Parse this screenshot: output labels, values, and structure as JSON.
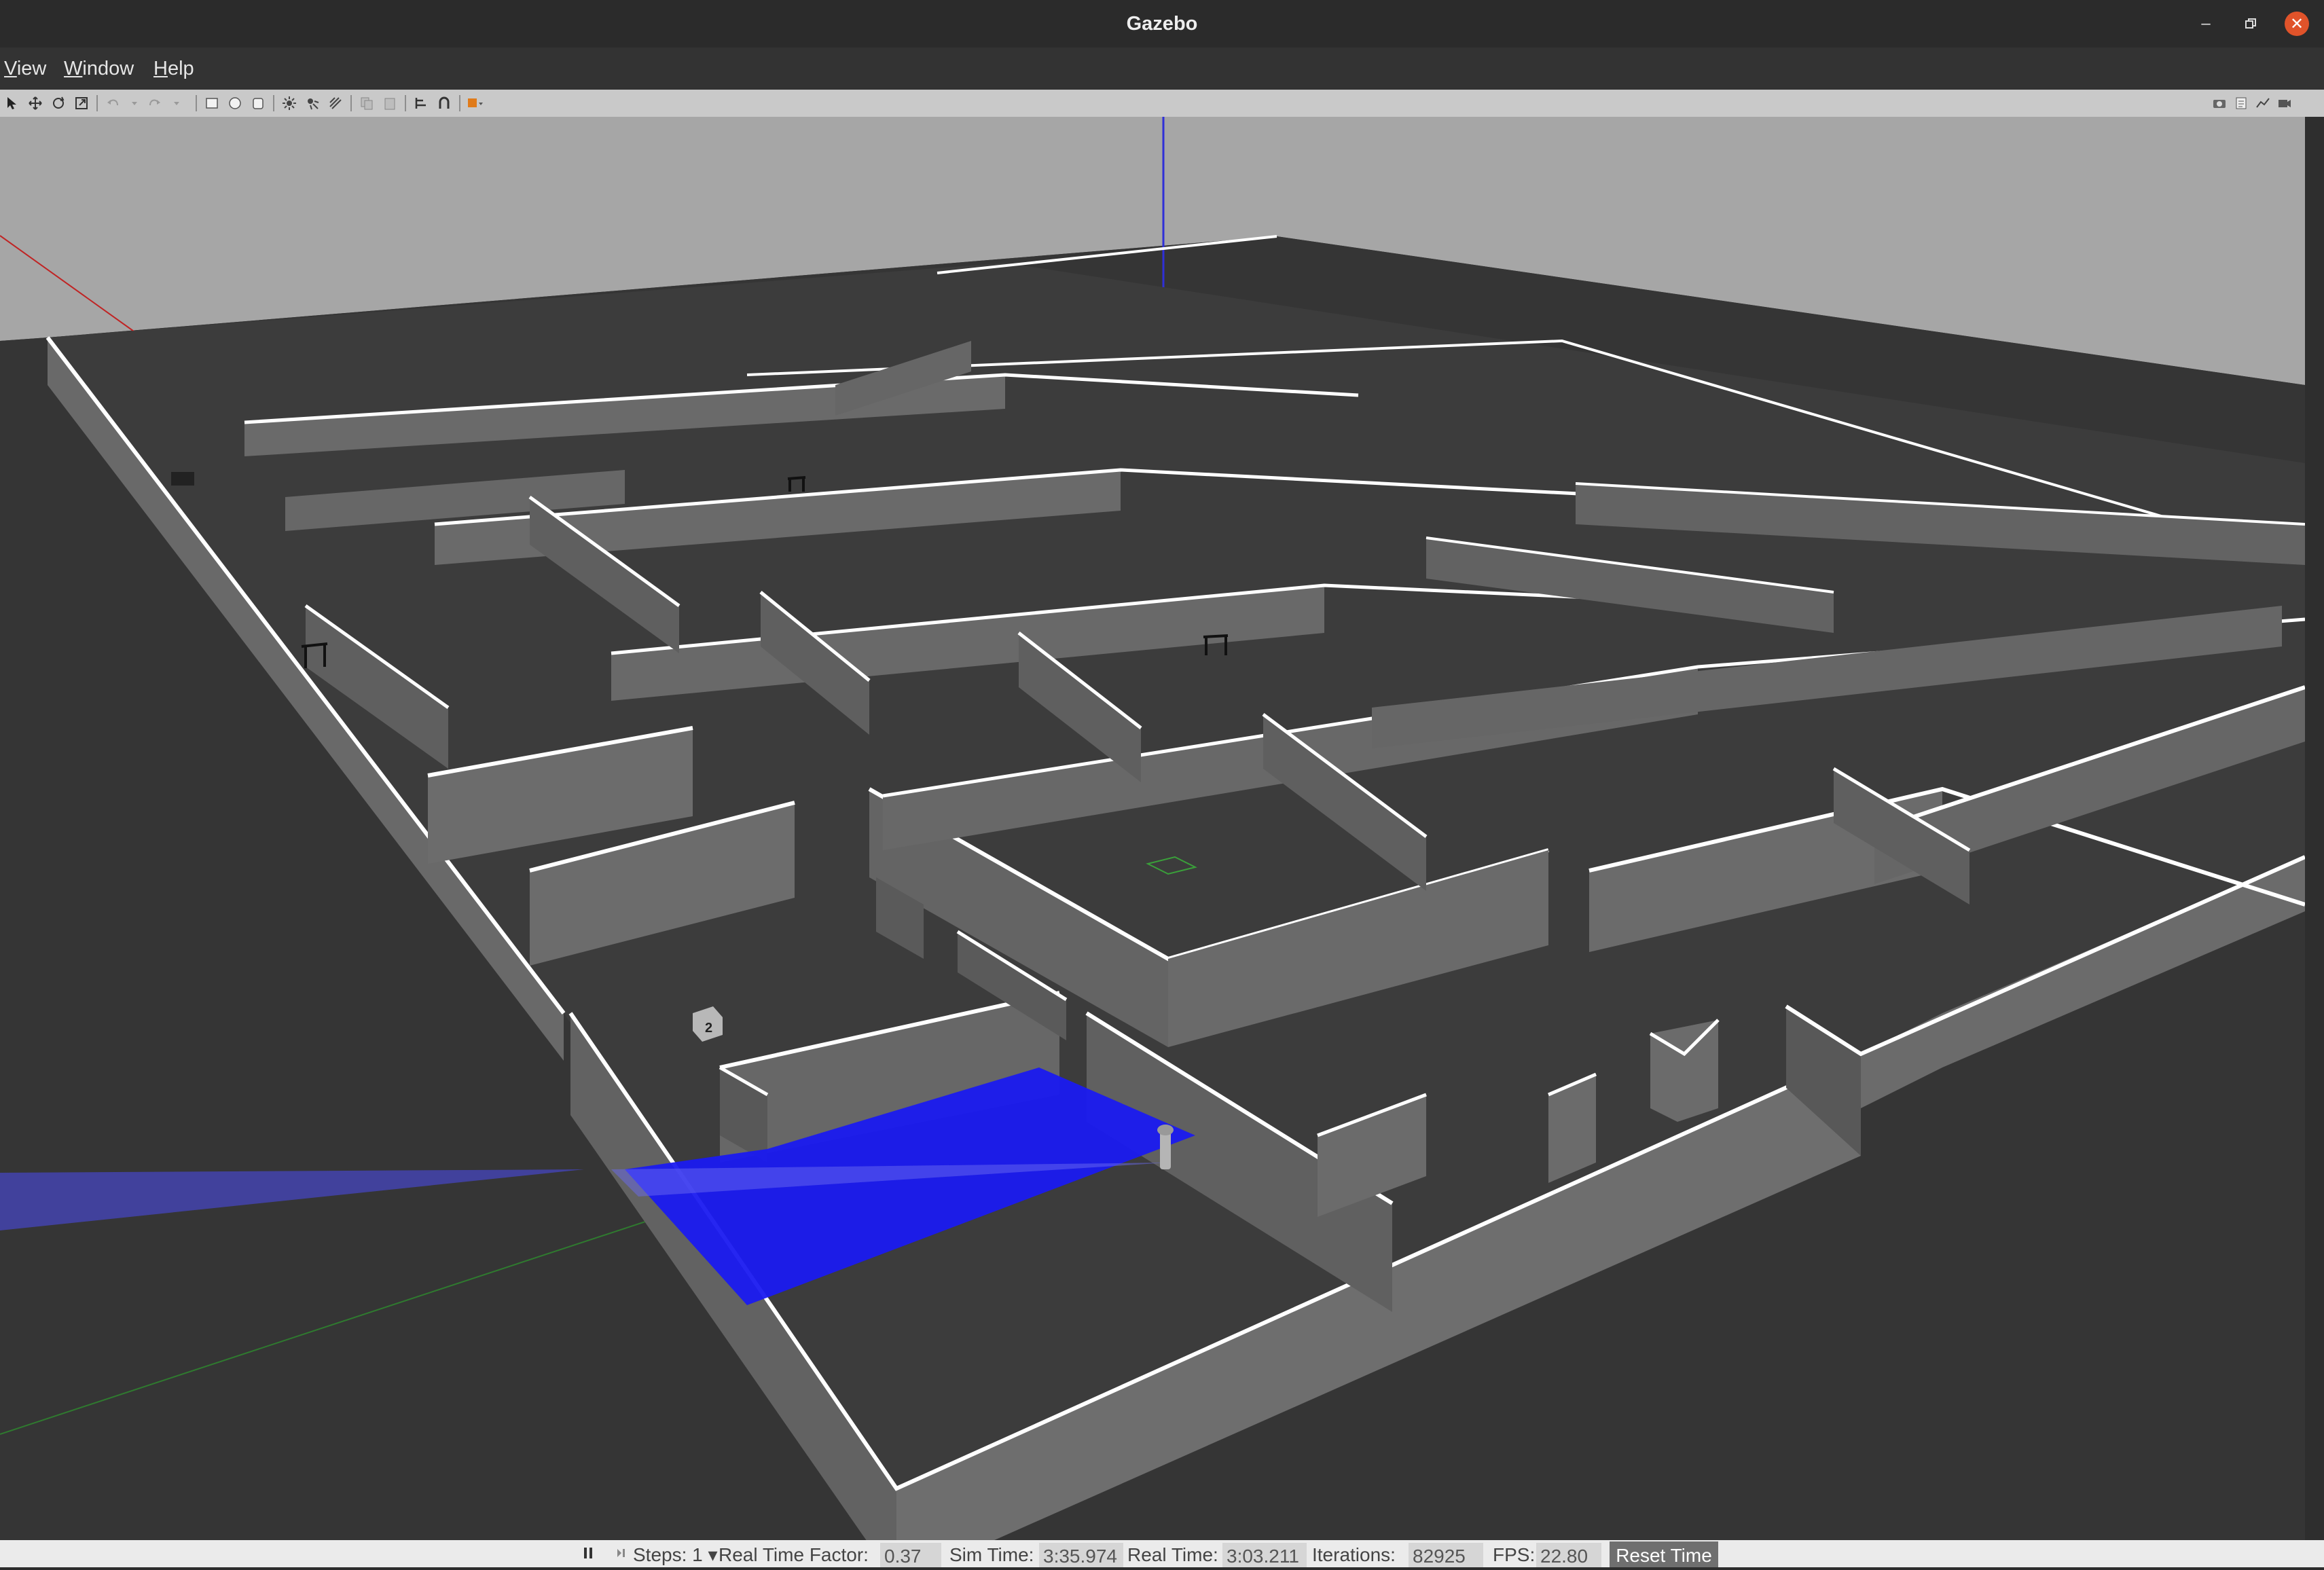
{
  "window": {
    "title": "Gazebo"
  },
  "menu": {
    "items": [
      {
        "mnemonic": "V",
        "rest": "iew"
      },
      {
        "mnemonic": "W",
        "rest": "indow"
      },
      {
        "mnemonic": "H",
        "rest": "elp"
      }
    ]
  },
  "toolbar": {
    "tools": [
      "select-arrow-icon",
      "translate-icon",
      "rotate-icon",
      "scale-icon",
      "undo-icon",
      "redo-icon",
      "box-shape-icon",
      "sphere-shape-icon",
      "cylinder-shape-icon",
      "point-light-icon",
      "spot-light-icon",
      "directional-light-icon",
      "copy-icon",
      "paste-icon",
      "align-icon",
      "snap-icon",
      "view-angle-icon"
    ],
    "right_tools": [
      "screenshot-icon",
      "log-icon",
      "plot-icon",
      "video-record-icon"
    ]
  },
  "status": {
    "steps_label": "Steps: 1",
    "rtf_label": "Real Time Factor:",
    "rtf_value": "0.37",
    "sim_time_label": "Sim Time:",
    "sim_time_value": "3:35.974",
    "real_time_label": "Real Time:",
    "real_time_value": "3:03.211",
    "iterations_label": "Iterations:",
    "iterations_value": "82925",
    "fps_label": "FPS:",
    "fps_value": "22.80",
    "reset_label": "Reset Time"
  },
  "scene": {
    "sky_color": "#a6a6a6",
    "ground_color": "#353535",
    "wall_color": "#6a6a6a",
    "laser_color": "#1a1af0",
    "marker_label": "2"
  }
}
